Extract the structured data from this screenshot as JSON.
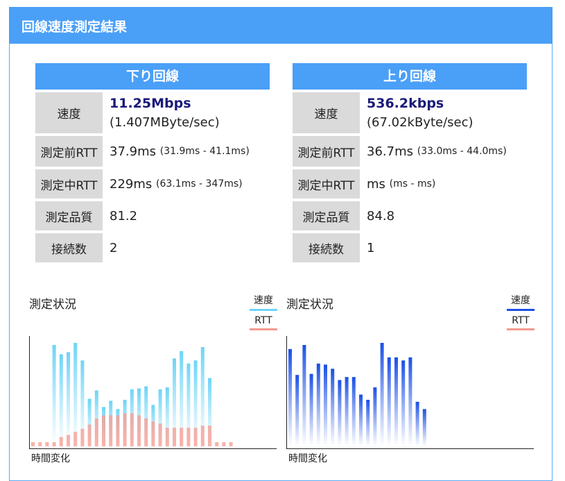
{
  "header": {
    "title": "回線速度測定結果"
  },
  "download": {
    "title": "下り回線",
    "speed_label": "速度",
    "speed_main": "11.25Mbps",
    "speed_sub": "(1.407MByte/sec)",
    "rtt_before_label": "測定前RTT",
    "rtt_before_value": "37.9ms",
    "rtt_before_range": "(31.9ms - 41.1ms)",
    "rtt_during_label": "測定中RTT",
    "rtt_during_value": "229ms",
    "rtt_during_range": "(63.1ms - 347ms)",
    "quality_label": "測定品質",
    "quality_value": "81.2",
    "connections_label": "接続数",
    "connections_value": "2"
  },
  "upload": {
    "title": "上り回線",
    "speed_label": "速度",
    "speed_main": "536.2kbps",
    "speed_sub": "(67.02kByte/sec)",
    "rtt_before_label": "測定前RTT",
    "rtt_before_value": "36.7ms",
    "rtt_before_range": "(33.0ms - 44.0ms)",
    "rtt_during_label": "測定中RTT",
    "rtt_during_value": "ms",
    "rtt_during_range": "(ms - ms)",
    "quality_label": "測定品質",
    "quality_value": "84.8",
    "connections_label": "接続数",
    "connections_value": "1"
  },
  "chart_data": [
    {
      "type": "bar",
      "title": "測定状況",
      "xlabel": "時間変化",
      "legend_placement": "top-right",
      "ylim": [
        0,
        1
      ],
      "series": [
        {
          "name": "速度",
          "color": "#6dd4f7",
          "values": [
            0,
            0,
            0,
            0.98,
            0.89,
            0.91,
            1.0,
            0.83,
            0.46,
            0.54,
            0.38,
            0.44,
            0.36,
            0.45,
            0.55,
            0.56,
            0.58,
            0.4,
            0.55,
            0.57,
            0.85,
            0.92,
            0.8,
            0.83,
            0.96,
            0.66,
            0,
            0,
            0
          ]
        },
        {
          "name": "RTT",
          "color": "#f59a8f",
          "values": [
            0.04,
            0.04,
            0.04,
            0.04,
            0.09,
            0.11,
            0.14,
            0.17,
            0.21,
            0.27,
            0.3,
            0.3,
            0.3,
            0.32,
            0.32,
            0.3,
            0.27,
            0.24,
            0.22,
            0.18,
            0.18,
            0.18,
            0.18,
            0.18,
            0.2,
            0.2,
            0.04,
            0.04,
            0.04
          ]
        }
      ]
    },
    {
      "type": "bar",
      "title": "測定状況",
      "xlabel": "時間変化",
      "legend_placement": "top-right",
      "ylim": [
        0,
        1
      ],
      "series": [
        {
          "name": "速度",
          "color": "#1a4fe6",
          "values": [
            0.94,
            0.69,
            0.98,
            0.7,
            0.8,
            0.79,
            0.75,
            0.64,
            0.67,
            0.67,
            0.5,
            0.45,
            0.57,
            1.0,
            0.86,
            0.86,
            0.83,
            0.86,
            0.43,
            0.36
          ]
        },
        {
          "name": "RTT",
          "color": "#f59a8f",
          "values": []
        }
      ]
    }
  ]
}
